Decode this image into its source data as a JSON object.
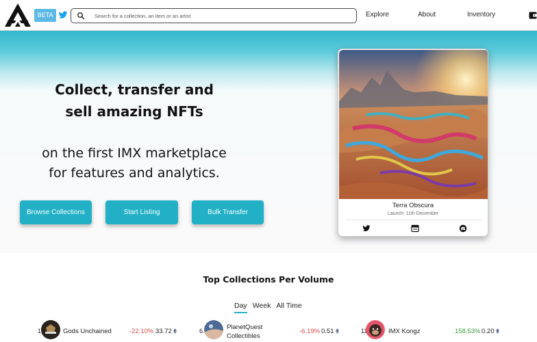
{
  "header": {
    "beta_label": "BETA",
    "search_placeholder": "Search for a collection, an item or an artist",
    "nav": {
      "explore": "Explore",
      "about": "About",
      "inventory": "Inventory"
    },
    "icons": {
      "logo": "arc-logo",
      "twitter": "twitter-icon",
      "search": "search-icon",
      "wallet": "wallet-icon"
    },
    "colors": {
      "beta_bg": "#5cb8e4",
      "twitter": "#1da1f2"
    }
  },
  "hero": {
    "title_line1": "Collect, transfer and",
    "title_line2": "sell amazing NFTs",
    "subtitle_line1": "on the first IMX marketplace",
    "subtitle_line2": "for features and analytics.",
    "buttons": {
      "browse": "Browse Collections",
      "start": "Start Listing",
      "bulk": "Bulk Transfer"
    },
    "accent_color": "#21b0c5"
  },
  "featured": {
    "title": "Terra Obscura",
    "launch": "Launch: 11th December",
    "icons": [
      "twitter-icon",
      "website-icon",
      "discord-icon"
    ]
  },
  "top_collections": {
    "title": "Top Collections Per Volume",
    "tabs": [
      "Day",
      "Week",
      "All Time"
    ],
    "active_tab": "Day",
    "rows": [
      {
        "rank": "1.",
        "name": "Gods Unchained",
        "change": "-22.10%",
        "volume": "33.72"
      },
      {
        "rank": "6.",
        "name_line1": "PlanetQuest",
        "name_line2": "Collectibles",
        "change": "-6.19%",
        "volume": "0.51"
      },
      {
        "rank": "11.",
        "name": "IMX Kongz",
        "change": "158.53%",
        "volume": "0.20"
      }
    ]
  }
}
